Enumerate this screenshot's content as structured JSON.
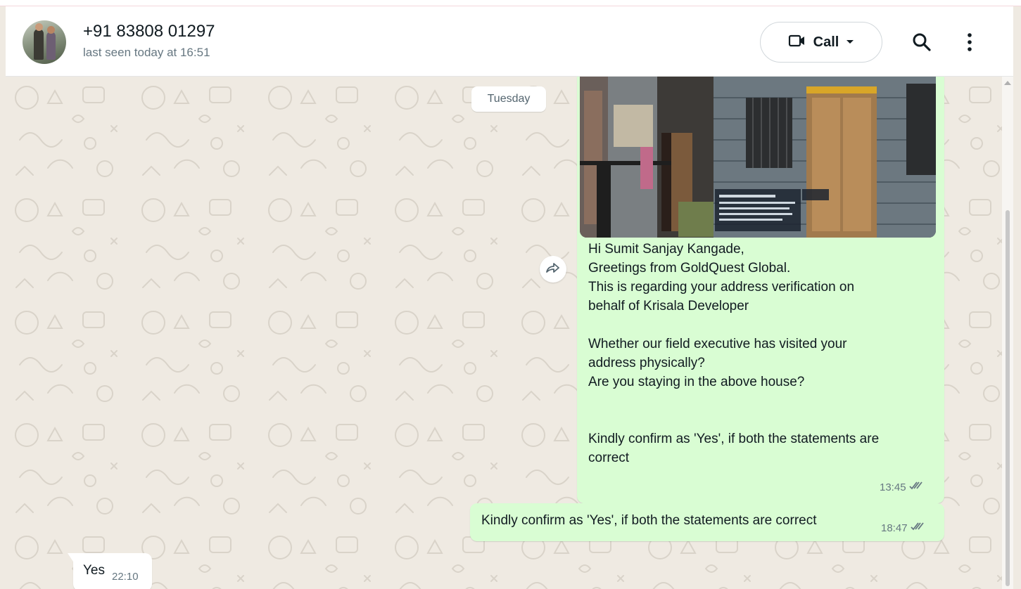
{
  "header": {
    "contact_name": "+91 83808 01297",
    "status": "last seen today at 16:51",
    "call_label": "Call"
  },
  "chat": {
    "date_divider": "Tuesday",
    "messages": [
      {
        "direction": "outgoing",
        "has_image": true,
        "lines": [
          "Hi Sumit Sanjay Kangade,",
          "Greetings from GoldQuest Global.",
          "This is regarding your address verification on",
          "behalf of Krisala Developer",
          "",
          "Whether our field executive has visited your",
          "address physically?",
          "Are you staying in the above house?",
          "",
          "",
          "Kindly confirm as 'Yes', if both the statements are",
          "correct"
        ],
        "time": "13:45",
        "status": "read"
      },
      {
        "direction": "outgoing",
        "text": "Kindly confirm as 'Yes', if both the statements are correct",
        "time": "18:47",
        "status": "read"
      },
      {
        "direction": "incoming",
        "text": "Yes",
        "time": "22:10"
      }
    ]
  },
  "icons": {
    "call": "video-camera-icon",
    "dropdown": "caret-down-icon",
    "search": "search-icon",
    "menu": "kebab-menu-icon",
    "forward": "forward-icon",
    "ticks": "double-check-icon"
  },
  "colors": {
    "outgoing_bubble": "#d9fdd3",
    "incoming_bubble": "#ffffff",
    "chat_background": "#efeae2",
    "read_ticks": "#667781"
  }
}
